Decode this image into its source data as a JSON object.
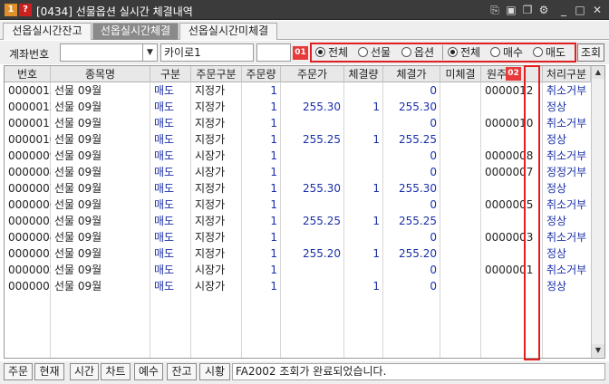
{
  "window": {
    "title": "[0434] 선물옵션 실시간 체결내역",
    "icon_primary": "1",
    "icon_help": "?"
  },
  "tabs": [
    {
      "label": "선옵실시간잔고",
      "active": false
    },
    {
      "label": "선옵실시간체결",
      "active": true
    },
    {
      "label": "선옵실시간미체결",
      "active": false
    }
  ],
  "filter": {
    "account_label": "계좌번호",
    "account_value": "",
    "account_name": "카이로1",
    "password_value": "",
    "badge_01": "01",
    "badge_02": "02",
    "product_radios": [
      {
        "label": "전체",
        "checked": true
      },
      {
        "label": "선물",
        "checked": false
      },
      {
        "label": "옵션",
        "checked": false
      }
    ],
    "side_radios": [
      {
        "label": "전체",
        "checked": true
      },
      {
        "label": "매수",
        "checked": false
      },
      {
        "label": "매도",
        "checked": false
      }
    ],
    "query_button": "조회"
  },
  "table": {
    "columns": [
      "번호",
      "종목명",
      "구분",
      "주문구분",
      "주문량",
      "주문가",
      "체결량",
      "체결가",
      "미체결",
      "원주",
      "처리구분"
    ],
    "rows": [
      {
        "no": "0000013",
        "name": "선물 09월",
        "side": "매도",
        "type": "지정가",
        "qty": "1",
        "price": "",
        "fill_qty": "",
        "fill_price": "0",
        "unfilled": "",
        "orig": "0000012",
        "status": "취소거부"
      },
      {
        "no": "0000012",
        "name": "선물 09월",
        "side": "매도",
        "type": "지정가",
        "qty": "1",
        "price": "255.30",
        "fill_qty": "1",
        "fill_price": "255.30",
        "unfilled": "",
        "orig": "",
        "status": "정상"
      },
      {
        "no": "0000011",
        "name": "선물 09월",
        "side": "매도",
        "type": "지정가",
        "qty": "1",
        "price": "",
        "fill_qty": "",
        "fill_price": "0",
        "unfilled": "",
        "orig": "0000010",
        "status": "취소거부"
      },
      {
        "no": "0000010",
        "name": "선물 09월",
        "side": "매도",
        "type": "지정가",
        "qty": "1",
        "price": "255.25",
        "fill_qty": "1",
        "fill_price": "255.25",
        "unfilled": "",
        "orig": "",
        "status": "정상"
      },
      {
        "no": "0000009",
        "name": "선물 09월",
        "side": "매도",
        "type": "시장가",
        "qty": "1",
        "price": "",
        "fill_qty": "",
        "fill_price": "0",
        "unfilled": "",
        "orig": "0000008",
        "status": "취소거부"
      },
      {
        "no": "0000008",
        "name": "선물 09월",
        "side": "매도",
        "type": "시장가",
        "qty": "1",
        "price": "",
        "fill_qty": "",
        "fill_price": "0",
        "unfilled": "",
        "orig": "0000007",
        "status": "정정거부"
      },
      {
        "no": "0000007",
        "name": "선물 09월",
        "side": "매도",
        "type": "지정가",
        "qty": "1",
        "price": "255.30",
        "fill_qty": "1",
        "fill_price": "255.30",
        "unfilled": "",
        "orig": "",
        "status": "정상"
      },
      {
        "no": "0000006",
        "name": "선물 09월",
        "side": "매도",
        "type": "지정가",
        "qty": "1",
        "price": "",
        "fill_qty": "",
        "fill_price": "0",
        "unfilled": "",
        "orig": "0000005",
        "status": "취소거부"
      },
      {
        "no": "0000005",
        "name": "선물 09월",
        "side": "매도",
        "type": "지정가",
        "qty": "1",
        "price": "255.25",
        "fill_qty": "1",
        "fill_price": "255.25",
        "unfilled": "",
        "orig": "",
        "status": "정상"
      },
      {
        "no": "0000004",
        "name": "선물 09월",
        "side": "매도",
        "type": "지정가",
        "qty": "1",
        "price": "",
        "fill_qty": "",
        "fill_price": "0",
        "unfilled": "",
        "orig": "0000003",
        "status": "취소거부"
      },
      {
        "no": "0000003",
        "name": "선물 09월",
        "side": "매도",
        "type": "지정가",
        "qty": "1",
        "price": "255.20",
        "fill_qty": "1",
        "fill_price": "255.20",
        "unfilled": "",
        "orig": "",
        "status": "정상"
      },
      {
        "no": "0000002",
        "name": "선물 09월",
        "side": "매도",
        "type": "시장가",
        "qty": "1",
        "price": "",
        "fill_qty": "",
        "fill_price": "0",
        "unfilled": "",
        "orig": "0000001",
        "status": "취소거부"
      },
      {
        "no": "0000001",
        "name": "선물 09월",
        "side": "매도",
        "type": "시장가",
        "qty": "1",
        "price": "",
        "fill_qty": "1",
        "fill_price": "0",
        "unfilled": "",
        "orig": "",
        "status": "정상"
      }
    ]
  },
  "bottom": {
    "buttons": [
      "주문",
      "현재",
      "시간",
      "차트",
      "예수",
      "잔고",
      "시황"
    ],
    "status_message": "FA2002 조회가 완료되었습니다."
  },
  "colors": {
    "titlebar": "#3b3b3b",
    "active_tab": "#8a8a8a",
    "highlight_red": "#e02020",
    "value_blue": "#1a2fa8"
  }
}
